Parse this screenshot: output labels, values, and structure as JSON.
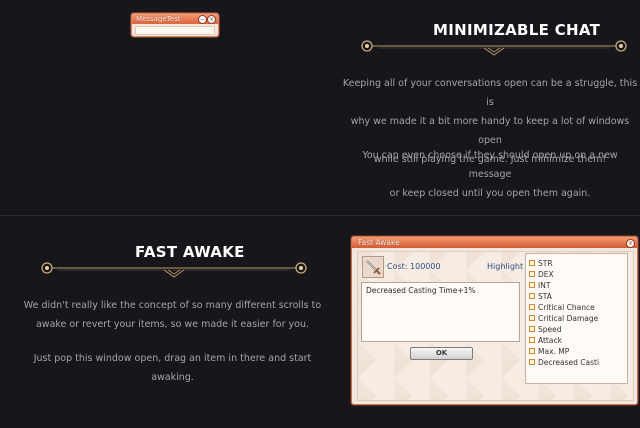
{
  "mini_window": {
    "title": "MessageTest",
    "minimize_glyph": "−",
    "close_glyph": "×"
  },
  "chat_section": {
    "title": "MINIMIZABLE CHAT",
    "paragraph1_lines": [
      "Keeping all of your conversations open can be a struggle, this is",
      "why we made it a bit more handy to keep a lot of windows open",
      "while still playing the game. Just minimize them!"
    ],
    "paragraph2_lines": [
      "You can even choose if they should open up on a new message",
      "or keep closed until you open them again."
    ]
  },
  "awake_section": {
    "title": "FAST AWAKE",
    "paragraph1_lines": [
      "We didn't really like the concept of so many different scrolls to",
      "awake or revert your items, so we made it easier for you."
    ],
    "paragraph2_lines": [
      "Just pop this window open, drag an item in there and start",
      "awaking."
    ]
  },
  "awake_window": {
    "title": "Fast Awake",
    "close_glyph": "×",
    "item_icon": "sword-icon",
    "cost_text": "Cost: 100000",
    "highlight_label": "Highlight",
    "stat_text": "Decreased Casting Time+1%",
    "ok_label": "OK",
    "options": [
      "STR",
      "DEX",
      "INT",
      "STA",
      "Critical Chance",
      "Critical Damage",
      "Speed",
      "Attack",
      "Max. MP",
      "Decreased Casti"
    ]
  },
  "colors": {
    "background": "#16161b",
    "title_bar": "#e07248",
    "link_blue": "#2a4f86",
    "ornament_gold": "#b89a6a"
  }
}
